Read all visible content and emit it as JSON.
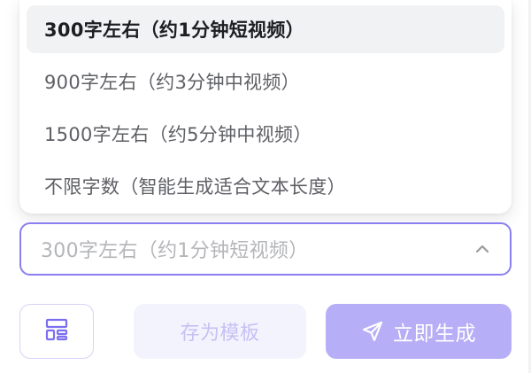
{
  "length_options": [
    {
      "label": "300字左右（约1分钟短视频）",
      "selected": true
    },
    {
      "label": "900字左右（约3分钟中视频）",
      "selected": false
    },
    {
      "label": "1500字左右（约5分钟中视频）",
      "selected": false
    },
    {
      "label": "不限字数（智能生成适合文本长度）",
      "selected": false
    }
  ],
  "length_select": {
    "value": "300字左右（约1分钟短视频）",
    "chevron_icon": "chevron-up-icon"
  },
  "actions": {
    "layout_icon": "layout-icon",
    "save_template_label": "存为模板",
    "generate_label": "立即生成",
    "generate_icon": "send-icon"
  },
  "colors": {
    "accent": "#8a7ff0",
    "generate_bg": "#b6aef6",
    "template_bg": "#f3f3fe",
    "template_text": "#c5c1f3",
    "selected_option_bg": "#f1f2f4"
  }
}
